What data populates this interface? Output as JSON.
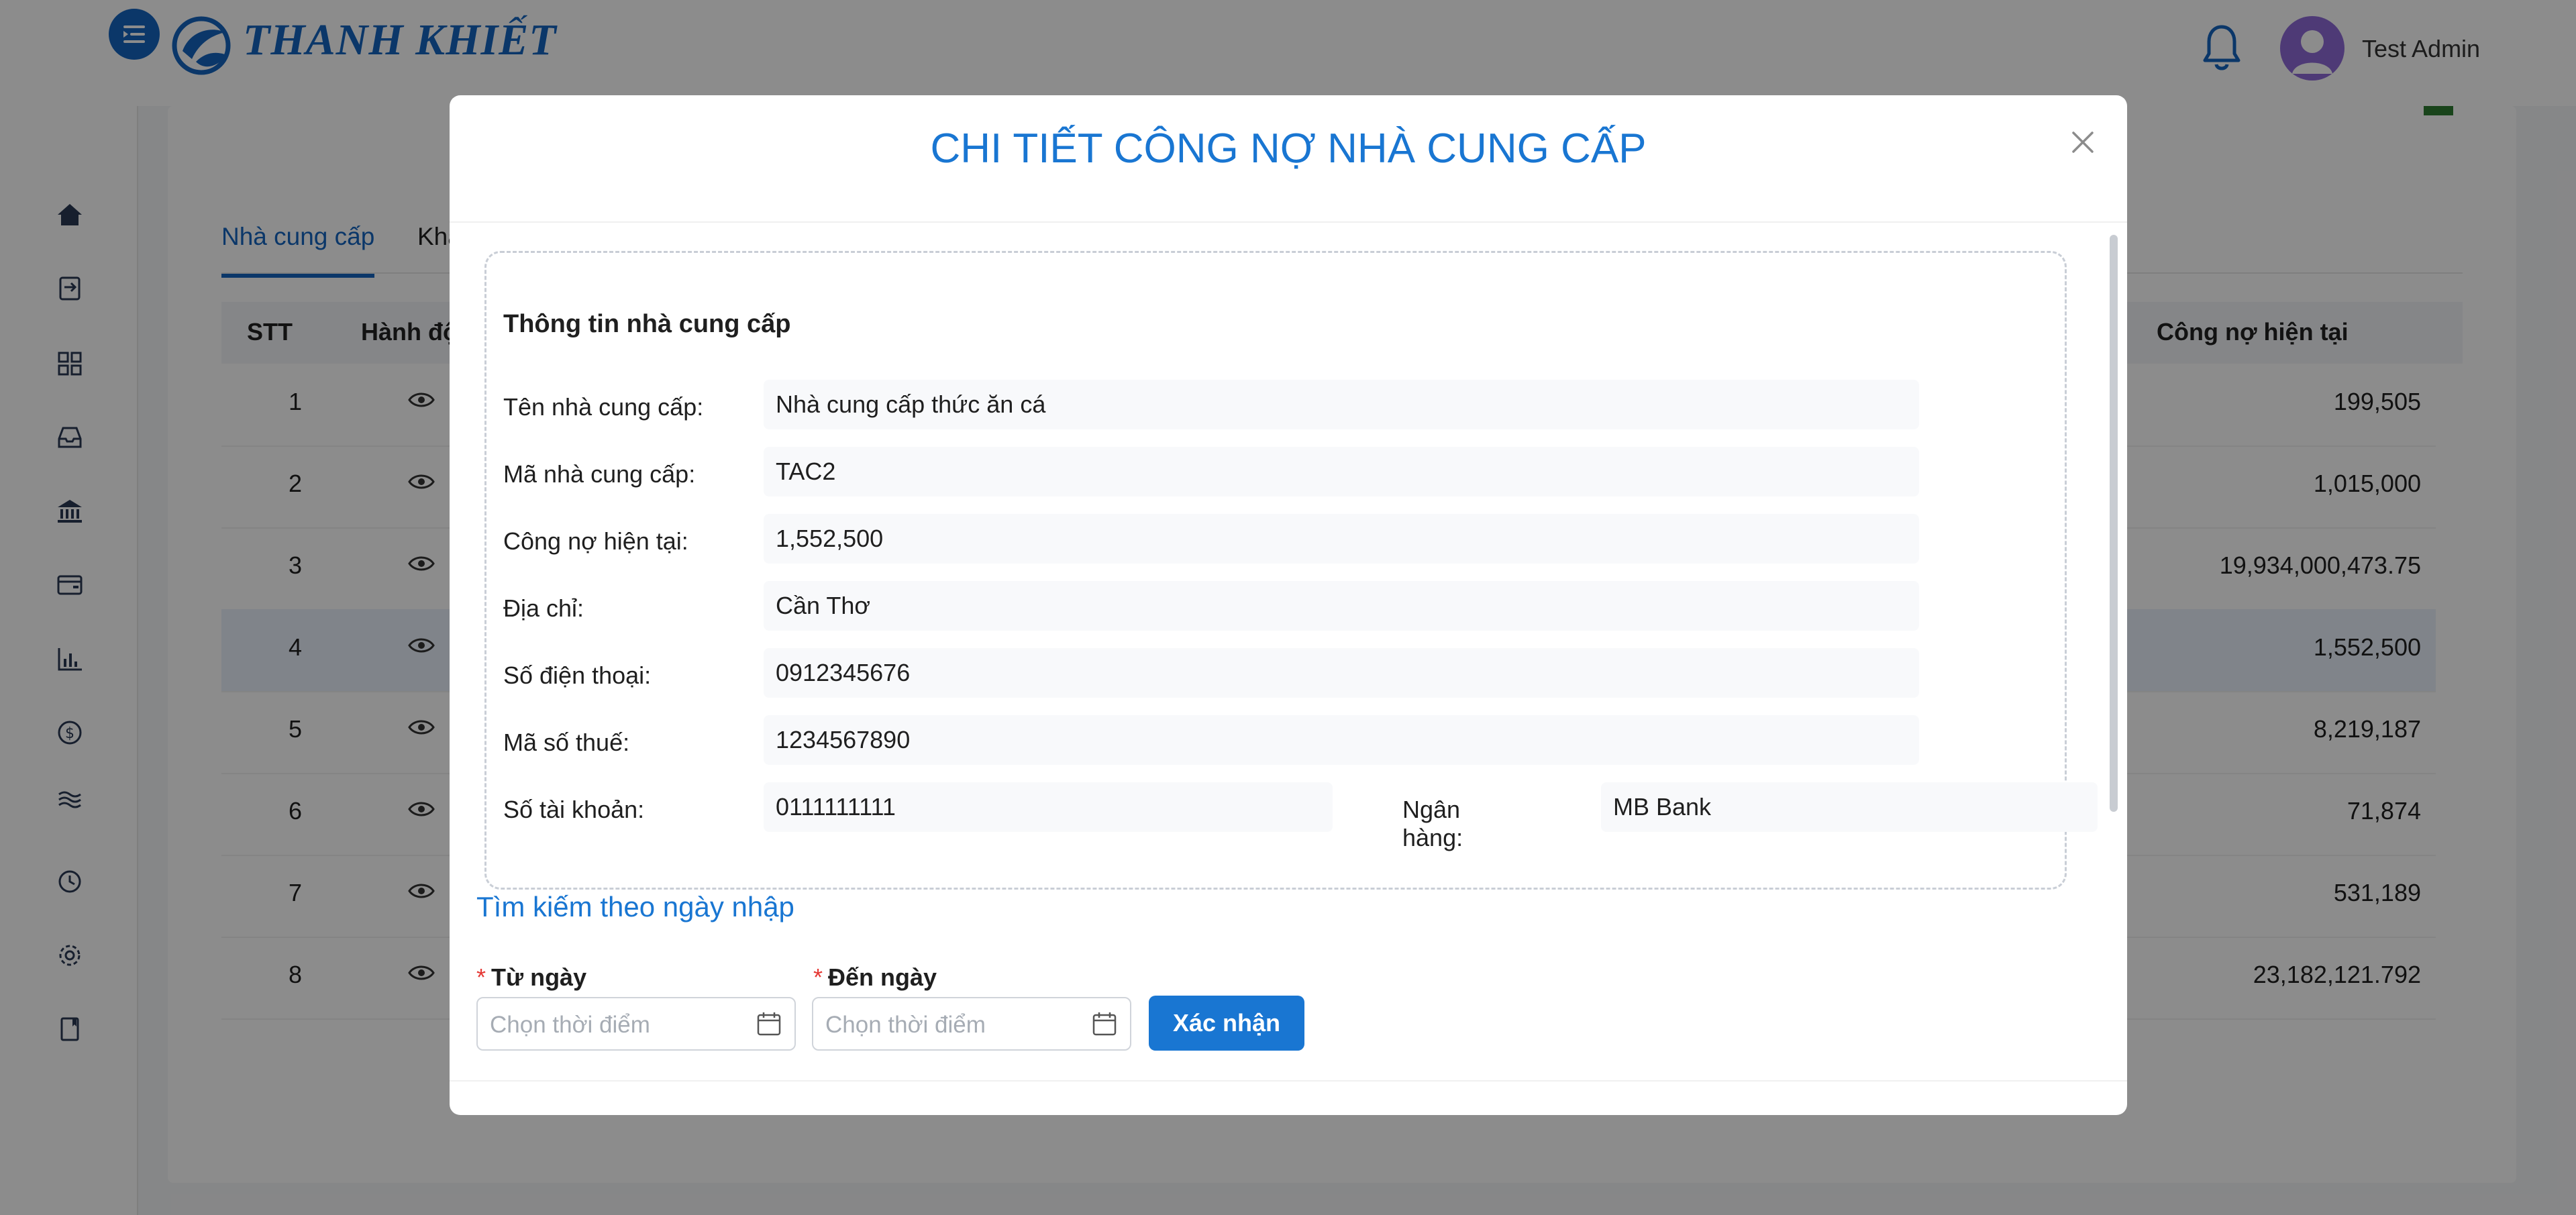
{
  "app": {
    "brand": "THANH KHIẾT",
    "user_name": "Test Admin"
  },
  "background": {
    "tabs": [
      "Nhà cung cấp",
      "Kha"
    ],
    "columns": {
      "stt": "STT",
      "actions": "Hành độ",
      "current_debt": "Công nợ hiện tại"
    },
    "rows": [
      {
        "stt": "1",
        "debt": "199,505"
      },
      {
        "stt": "2",
        "debt": "1,015,000"
      },
      {
        "stt": "3",
        "debt": "19,934,000,473.75"
      },
      {
        "stt": "4",
        "debt": "1,552,500"
      },
      {
        "stt": "5",
        "debt": "8,219,187"
      },
      {
        "stt": "6",
        "debt": "71,874"
      },
      {
        "stt": "7",
        "debt": "531,189"
      },
      {
        "stt": "8",
        "debt": "23,182,121.792"
      }
    ],
    "selected_row": "4"
  },
  "modal": {
    "title": "CHI TIẾT CÔNG NỢ NHÀ CUNG CẤP",
    "section_title": "Thông tin nhà cung cấp",
    "fields": {
      "name": {
        "label": "Tên nhà cung cấp:",
        "value": "Nhà cung cấp thức ăn cá"
      },
      "code": {
        "label": "Mã nhà cung cấp:",
        "value": "TAC2"
      },
      "debt": {
        "label": "Công nợ hiện tại:",
        "value": "1,552,500"
      },
      "address": {
        "label": "Địa chỉ:",
        "value": "Cần Thơ"
      },
      "phone": {
        "label": "Số điện thoại:",
        "value": "0912345676"
      },
      "tax": {
        "label": "Mã số thuế:",
        "value": "1234567890"
      },
      "account": {
        "label": "Số tài khoản:",
        "value": "0111111111"
      },
      "bank": {
        "label": "Ngân hàng:",
        "value": "MB Bank"
      }
    },
    "search": {
      "title": "Tìm kiếm theo ngày nhập",
      "required_mark": "*",
      "from_label": "Từ ngày",
      "to_label": "Đến ngày",
      "placeholder": "Chọn thời điểm",
      "confirm_label": "Xác nhận"
    }
  },
  "colors": {
    "primary": "#1976d2",
    "brand": "#1565c0",
    "avatar": "#8e6ad8",
    "required": "#e53935"
  }
}
